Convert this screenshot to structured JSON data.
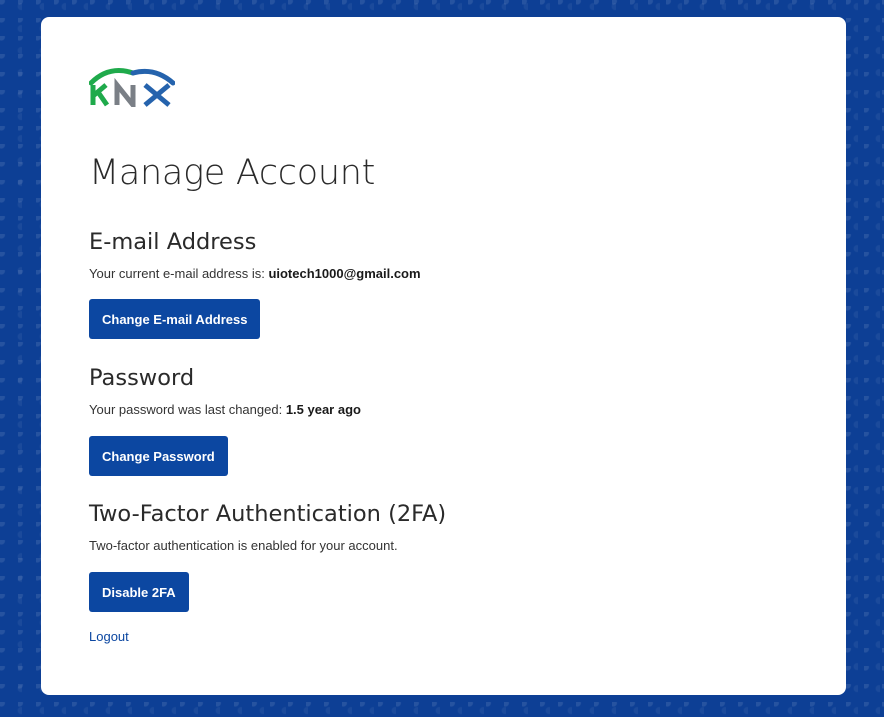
{
  "brand": {
    "logo_text": "KNX",
    "colors": {
      "green": "#1faa4b",
      "blue": "#2563ad",
      "gray": "#7a7f86",
      "primary_button": "#0c47a1",
      "background": "#0d3f95"
    }
  },
  "page": {
    "title": "Manage Account"
  },
  "email_section": {
    "heading": "E-mail Address",
    "description_prefix": "Your current e-mail address is: ",
    "email": "uiotech1000@gmail.com",
    "button_label": "Change E-mail Address"
  },
  "password_section": {
    "heading": "Password",
    "description_prefix": "Your password was last changed: ",
    "last_changed": "1.5 year ago",
    "button_label": "Change Password"
  },
  "twofa_section": {
    "heading": "Two-Factor Authentication (2FA)",
    "description": "Two-factor authentication is enabled for your account.",
    "button_label": "Disable 2FA"
  },
  "footer": {
    "logout_label": "Logout"
  }
}
